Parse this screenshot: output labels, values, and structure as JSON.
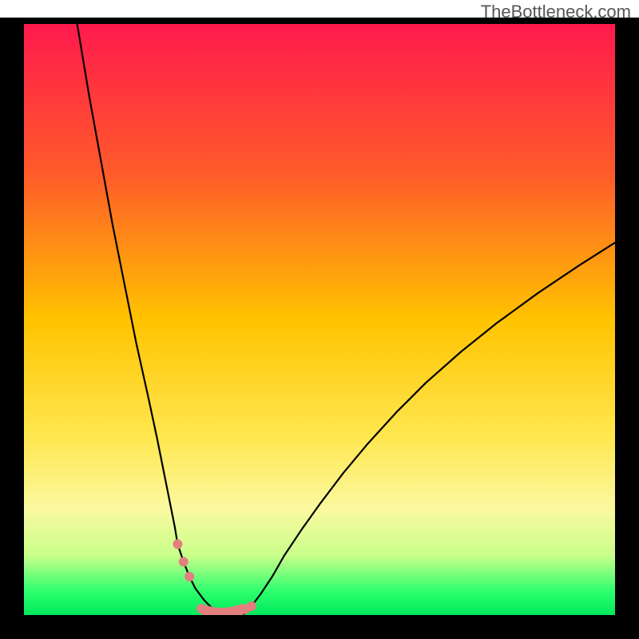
{
  "watermark": "TheBottleneck.com",
  "chart_data": {
    "type": "line",
    "title": "",
    "xlabel": "",
    "ylabel": "",
    "xlim": [
      0,
      100
    ],
    "ylim": [
      0,
      100
    ],
    "gradient_stops": [
      {
        "offset": 0.0,
        "color": "#ff1a4d"
      },
      {
        "offset": 0.25,
        "color": "#ff5a2a"
      },
      {
        "offset": 0.5,
        "color": "#ffc300"
      },
      {
        "offset": 0.7,
        "color": "#ffe750"
      },
      {
        "offset": 0.82,
        "color": "#fbf9a0"
      },
      {
        "offset": 0.9,
        "color": "#c8ff8a"
      },
      {
        "offset": 0.96,
        "color": "#2dff6e"
      },
      {
        "offset": 1.0,
        "color": "#00e85a"
      }
    ],
    "series": [
      {
        "name": "left_curve",
        "x": [
          9,
          11,
          13,
          15,
          17,
          19,
          21,
          22.5,
          23.5,
          24.5,
          25.5,
          26,
          27,
          28,
          29,
          30.5,
          32,
          34.5
        ],
        "y": [
          100,
          88,
          77,
          66,
          56,
          46,
          37,
          30,
          25,
          20,
          15,
          12,
          9,
          6.5,
          4.5,
          2.5,
          1,
          0
        ]
      },
      {
        "name": "right_curve",
        "x": [
          37,
          38.5,
          40,
          42,
          44,
          47,
          50,
          54,
          58,
          63,
          68,
          74,
          80,
          87,
          94,
          100
        ],
        "y": [
          0,
          1.5,
          3.5,
          6.5,
          10,
          14.5,
          18.7,
          24,
          28.8,
          34.3,
          39.3,
          44.6,
          49.4,
          54.5,
          59.2,
          63
        ]
      }
    ],
    "annotations": {
      "left_dots": {
        "x": [
          26,
          27,
          28
        ],
        "y": [
          12,
          9,
          6.5
        ]
      },
      "right_dots": {
        "x": [
          38.5,
          37.5,
          36.5,
          34.5,
          33,
          31
        ],
        "y": [
          1.5,
          1.0,
          0.6,
          0.2,
          0.1,
          0.05
        ]
      },
      "valley_band": {
        "x0": 30,
        "x1": 37,
        "thickness_px": 12,
        "color": "#e37f7f"
      }
    }
  }
}
